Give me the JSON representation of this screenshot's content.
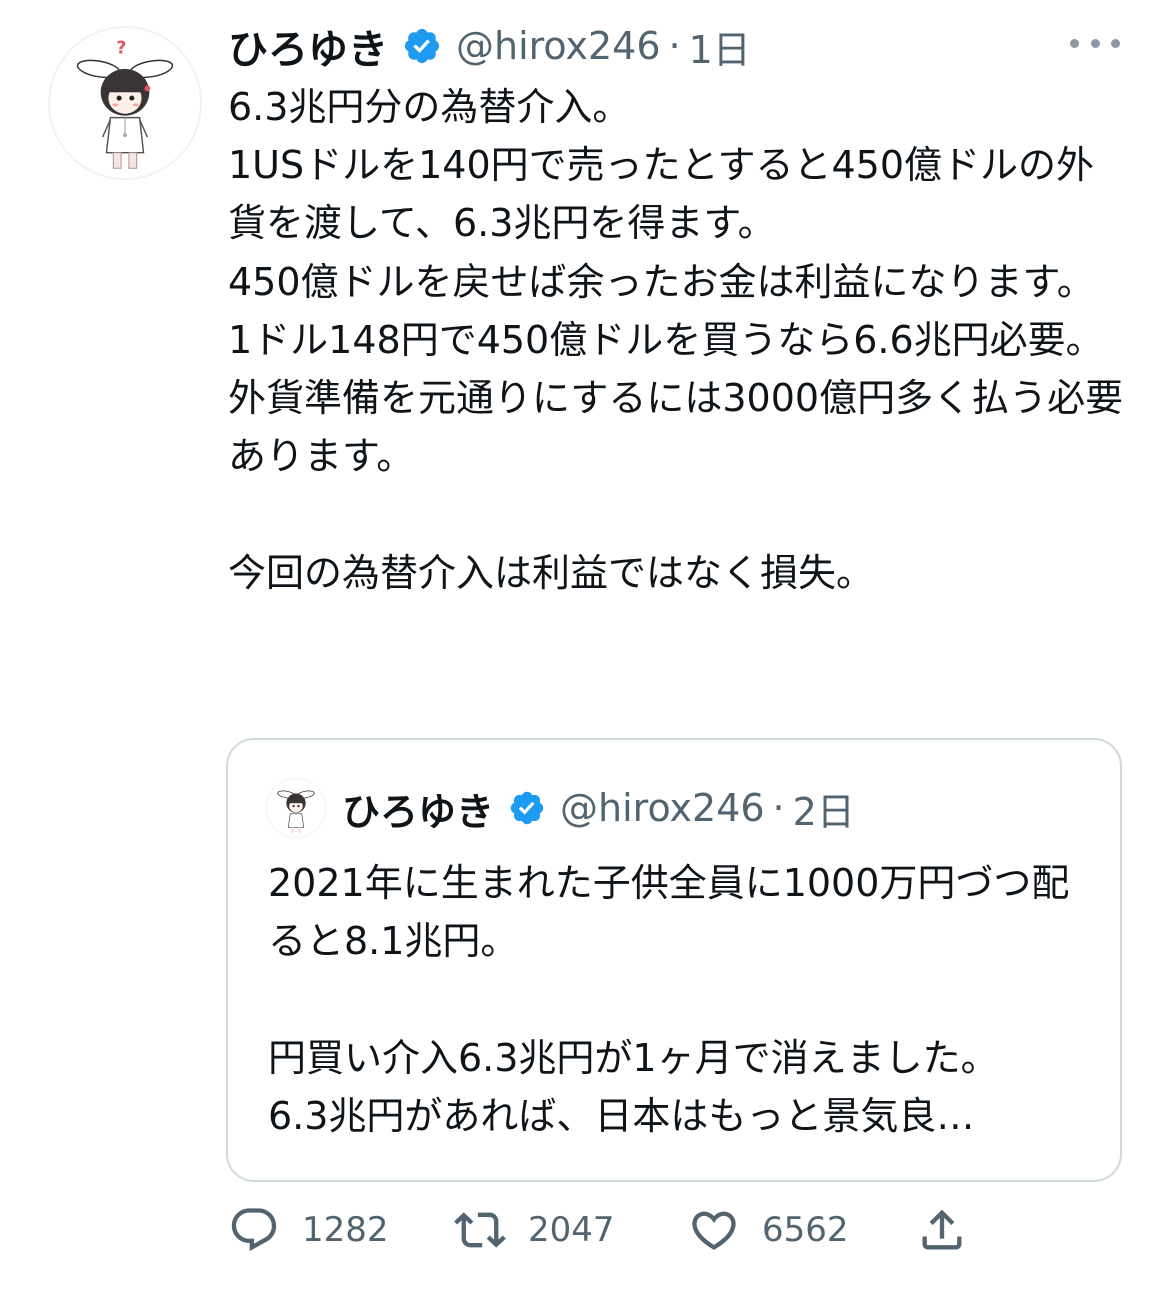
{
  "tweet": {
    "author": {
      "display_name": "ひろゆき",
      "handle": "@hirox246",
      "verified": true,
      "avatar_icon": "rabbit-eared-character-avatar"
    },
    "separator": "·",
    "time": "1日",
    "more_icon": "more-options-icon",
    "text": "6.3兆円分の為替介入。\n1USドルを140円で売ったとすると450億ドルの外貨を渡して、6.3兆円を得ます。\n450億ドルを戻せば余ったお金は利益になります。\n1ドル148円で450億ドルを買うなら6.6兆円必要。\n外貨準備を元通りにするには3000億円多く払う必要あります。\n\n今回の為替介入は利益ではなく損失。",
    "quoted": {
      "author": {
        "display_name": "ひろゆき",
        "handle": "@hirox246",
        "verified": true
      },
      "separator": "·",
      "time": "2日",
      "text": "2021年に生まれた子供全員に1000万円づつ配ると8.1兆円。\n\n円買い介入6.3兆円が1ヶ月で消えました。\n6.3兆円があれば、日本はもっと景気良…"
    },
    "actions": {
      "reply_count": "1282",
      "retweet_count": "2047",
      "like_count": "6562"
    }
  },
  "colors": {
    "text": "#0f1419",
    "secondary": "#536471",
    "verified": "#1d9bf0",
    "border": "#cfd9de",
    "icon": "#536471"
  }
}
